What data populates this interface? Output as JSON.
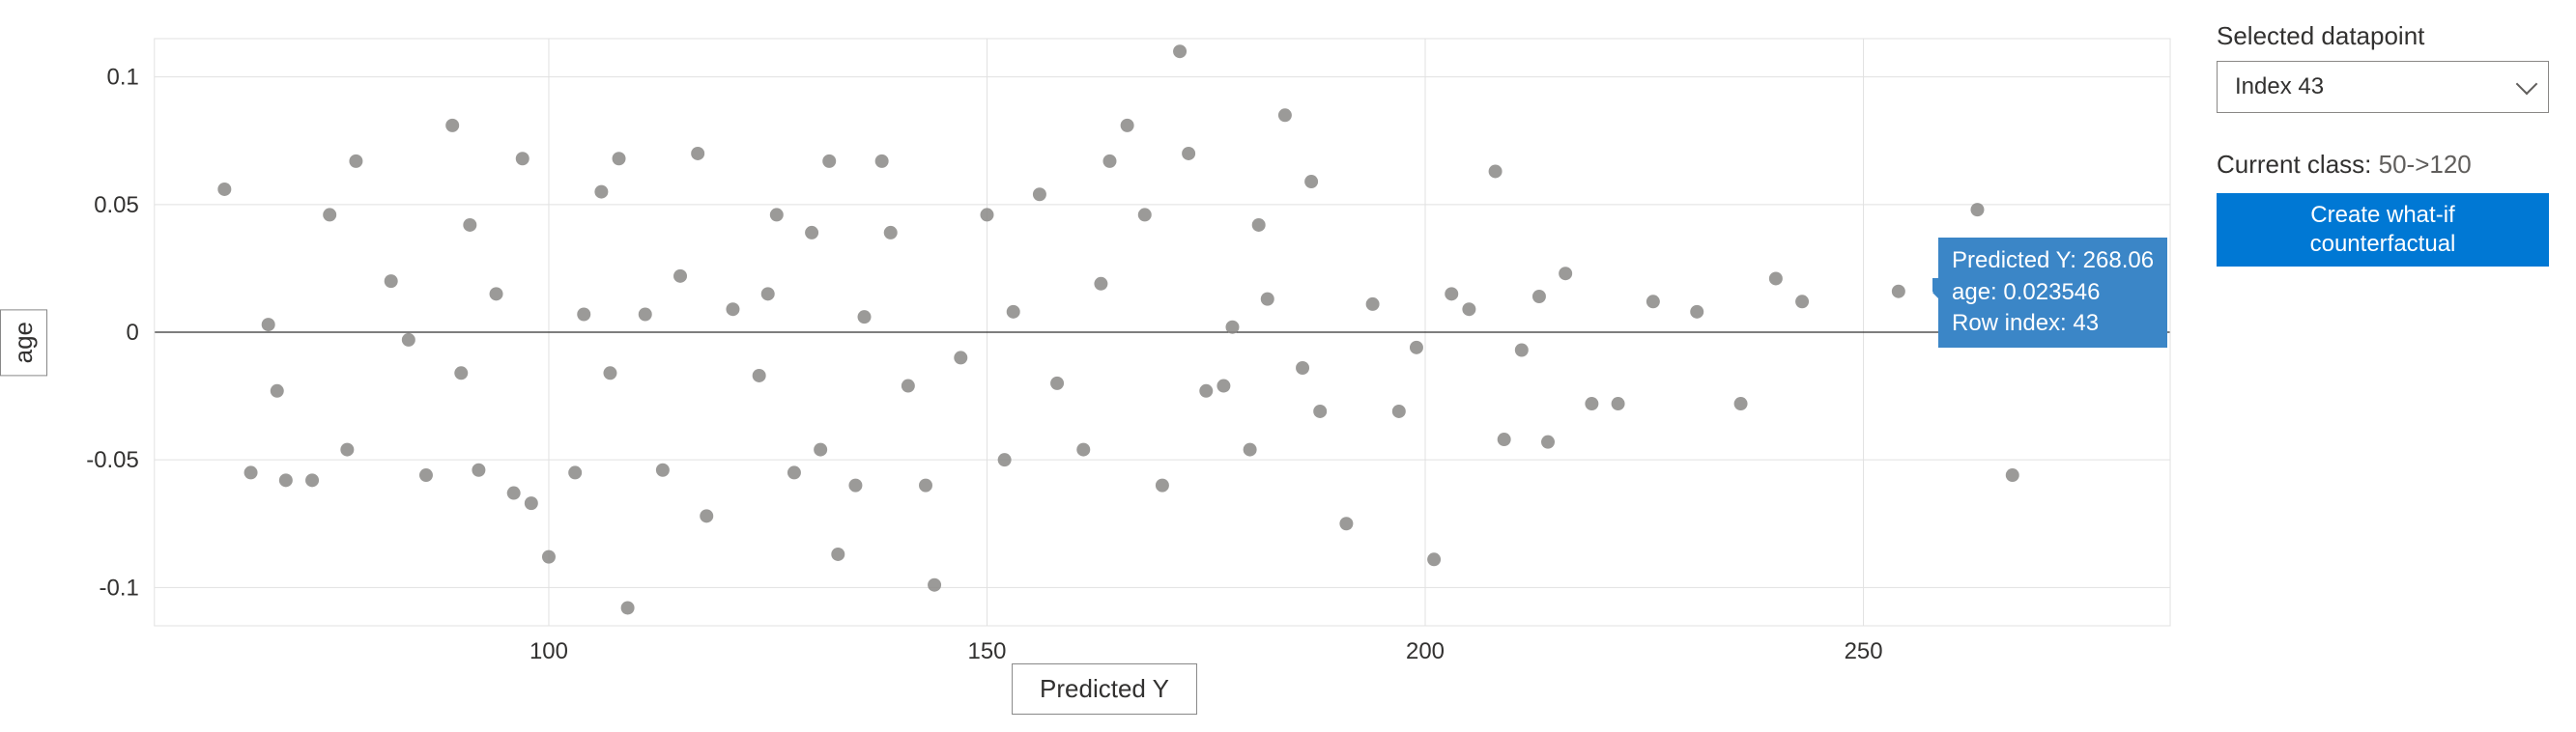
{
  "chart_data": {
    "type": "scatter",
    "xlabel": "Predicted Y",
    "ylabel": "age",
    "xlim": [
      55,
      285
    ],
    "ylim": [
      -0.115,
      0.115
    ],
    "x_ticks": [
      100,
      150,
      200,
      250
    ],
    "y_ticks": [
      -0.1,
      -0.05,
      0,
      0.05,
      0.1
    ],
    "baseline_y": 0,
    "series": [
      {
        "name": "datapoints",
        "color": "#8a8886",
        "points": [
          {
            "x": 63,
            "y": 0.056
          },
          {
            "x": 66,
            "y": -0.055
          },
          {
            "x": 68,
            "y": 0.003
          },
          {
            "x": 69,
            "y": -0.023
          },
          {
            "x": 70,
            "y": -0.058
          },
          {
            "x": 73,
            "y": -0.058
          },
          {
            "x": 75,
            "y": 0.046
          },
          {
            "x": 77,
            "y": -0.046
          },
          {
            "x": 78,
            "y": 0.067
          },
          {
            "x": 82,
            "y": 0.02
          },
          {
            "x": 84,
            "y": -0.003
          },
          {
            "x": 86,
            "y": -0.056
          },
          {
            "x": 89,
            "y": 0.081
          },
          {
            "x": 90,
            "y": -0.016
          },
          {
            "x": 91,
            "y": 0.042
          },
          {
            "x": 92,
            "y": -0.054
          },
          {
            "x": 94,
            "y": 0.015
          },
          {
            "x": 96,
            "y": -0.063
          },
          {
            "x": 97,
            "y": 0.068
          },
          {
            "x": 98,
            "y": -0.067
          },
          {
            "x": 100,
            "y": -0.088
          },
          {
            "x": 103,
            "y": -0.055
          },
          {
            "x": 104,
            "y": 0.007
          },
          {
            "x": 106,
            "y": 0.055
          },
          {
            "x": 107,
            "y": -0.016
          },
          {
            "x": 108,
            "y": 0.068
          },
          {
            "x": 109,
            "y": -0.108
          },
          {
            "x": 111,
            "y": 0.007
          },
          {
            "x": 113,
            "y": -0.054
          },
          {
            "x": 115,
            "y": 0.022
          },
          {
            "x": 117,
            "y": 0.07
          },
          {
            "x": 118,
            "y": -0.072
          },
          {
            "x": 121,
            "y": 0.009
          },
          {
            "x": 124,
            "y": -0.017
          },
          {
            "x": 125,
            "y": 0.015
          },
          {
            "x": 126,
            "y": 0.046
          },
          {
            "x": 128,
            "y": -0.055
          },
          {
            "x": 130,
            "y": 0.039
          },
          {
            "x": 131,
            "y": -0.046
          },
          {
            "x": 132,
            "y": 0.067
          },
          {
            "x": 133,
            "y": -0.087
          },
          {
            "x": 135,
            "y": -0.06
          },
          {
            "x": 136,
            "y": 0.006
          },
          {
            "x": 138,
            "y": 0.067
          },
          {
            "x": 139,
            "y": 0.039
          },
          {
            "x": 141,
            "y": -0.021
          },
          {
            "x": 143,
            "y": -0.06
          },
          {
            "x": 144,
            "y": -0.099
          },
          {
            "x": 147,
            "y": -0.01
          },
          {
            "x": 150,
            "y": 0.046
          },
          {
            "x": 152,
            "y": -0.05
          },
          {
            "x": 153,
            "y": 0.008
          },
          {
            "x": 156,
            "y": 0.054
          },
          {
            "x": 158,
            "y": -0.02
          },
          {
            "x": 161,
            "y": -0.046
          },
          {
            "x": 163,
            "y": 0.019
          },
          {
            "x": 164,
            "y": 0.067
          },
          {
            "x": 166,
            "y": 0.081
          },
          {
            "x": 168,
            "y": 0.046
          },
          {
            "x": 170,
            "y": -0.06
          },
          {
            "x": 172,
            "y": 0.11
          },
          {
            "x": 173,
            "y": 0.07
          },
          {
            "x": 175,
            "y": -0.023
          },
          {
            "x": 177,
            "y": -0.021
          },
          {
            "x": 178,
            "y": 0.002
          },
          {
            "x": 180,
            "y": -0.046
          },
          {
            "x": 181,
            "y": 0.042
          },
          {
            "x": 182,
            "y": 0.013
          },
          {
            "x": 184,
            "y": 0.085
          },
          {
            "x": 186,
            "y": -0.014
          },
          {
            "x": 187,
            "y": 0.059
          },
          {
            "x": 188,
            "y": -0.031
          },
          {
            "x": 191,
            "y": -0.075
          },
          {
            "x": 194,
            "y": 0.011
          },
          {
            "x": 197,
            "y": -0.031
          },
          {
            "x": 199,
            "y": -0.006
          },
          {
            "x": 201,
            "y": -0.089
          },
          {
            "x": 203,
            "y": 0.015
          },
          {
            "x": 205,
            "y": 0.009
          },
          {
            "x": 208,
            "y": 0.063
          },
          {
            "x": 209,
            "y": -0.042
          },
          {
            "x": 211,
            "y": -0.007
          },
          {
            "x": 213,
            "y": 0.014
          },
          {
            "x": 214,
            "y": -0.043
          },
          {
            "x": 216,
            "y": 0.023
          },
          {
            "x": 219,
            "y": -0.028
          },
          {
            "x": 222,
            "y": -0.028
          },
          {
            "x": 226,
            "y": 0.012
          },
          {
            "x": 231,
            "y": 0.008
          },
          {
            "x": 236,
            "y": -0.028
          },
          {
            "x": 240,
            "y": 0.021
          },
          {
            "x": 243,
            "y": 0.012
          },
          {
            "x": 254,
            "y": 0.016
          },
          {
            "x": 263,
            "y": 0.048
          },
          {
            "x": 267,
            "y": -0.056
          },
          {
            "x": 279,
            "y": 0.013
          }
        ]
      }
    ],
    "highlighted_point": {
      "x": 268.06,
      "y": 0.023546,
      "row_index": 43
    }
  },
  "tooltip": {
    "line1_label": "Predicted Y:",
    "line1_value": "268.06",
    "line2_label": "age:",
    "line2_value": "0.023546",
    "line3_label": "Row index:",
    "line3_value": "43"
  },
  "side": {
    "selected_label": "Selected datapoint",
    "selected_value": "Index 43",
    "current_class_label": "Current class:",
    "current_class_value": "50->120",
    "button_line1": "Create what-if",
    "button_line2": "counterfactual"
  }
}
